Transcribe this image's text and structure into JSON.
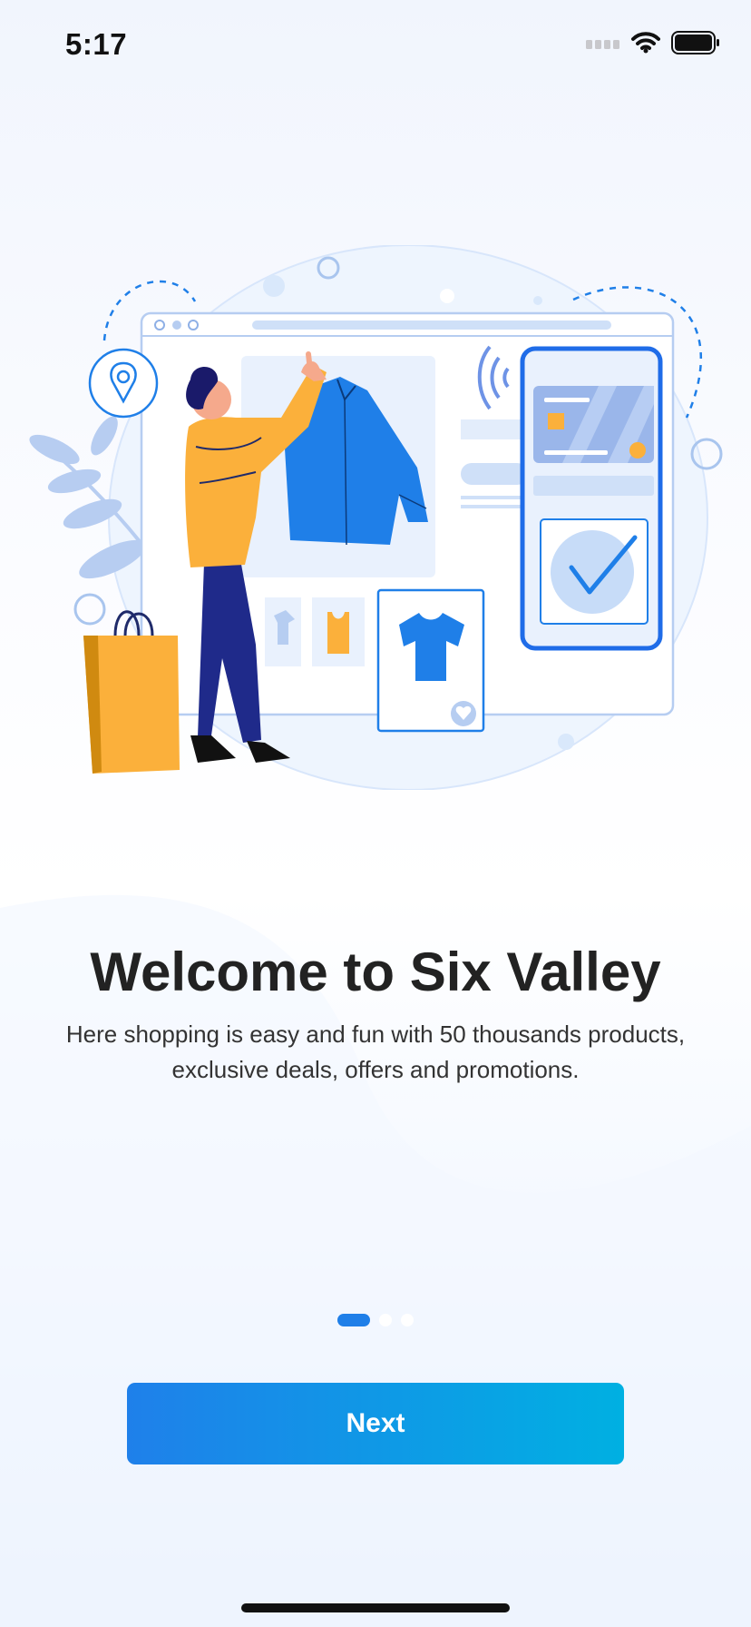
{
  "status_bar": {
    "time": "5:17",
    "icons": [
      "cellular-signal-icon",
      "wifi-icon",
      "battery-icon"
    ]
  },
  "illustration": {
    "subject": "online-shopping-illustration"
  },
  "onboarding": {
    "title": "Welcome to Six Valley",
    "description": "Here shopping is easy and fun with 50 thousands products, exclusive deals, offers and promotions.",
    "pagination": {
      "total": 3,
      "current": 1
    },
    "next_label": "Next"
  },
  "colors": {
    "accent": "#1f7fe8",
    "button_start": "#1f80ea",
    "button_end": "#00b0e2",
    "illustration_yellow": "#fbb03b",
    "illustration_navy": "#1f2a8a"
  }
}
